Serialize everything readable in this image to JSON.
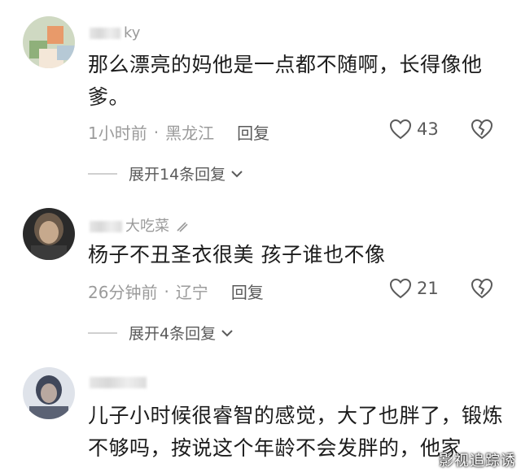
{
  "comments": [
    {
      "username_partial": "ky",
      "text": "那么漂亮的妈他是一点都不随啊，长得像他爹。",
      "time": "1小时前",
      "location": "黑龙江",
      "reply_label": "回复",
      "likes": "43",
      "expand_label": "展开14条回复"
    },
    {
      "username_partial": "大吃菜",
      "text": "杨子不丑圣衣很美 孩子谁也不像",
      "time": "26分钟前",
      "location": "辽宁",
      "reply_label": "回复",
      "likes": "21",
      "expand_label": "展开4条回复"
    },
    {
      "username_partial": "",
      "text": "儿子小时候很睿智的感觉，大了也胖了，锻炼不够吗，按说这个年龄不会发胖的，他家",
      "time": "",
      "location": "",
      "reply_label": "",
      "likes": "",
      "expand_label": ""
    }
  ],
  "watermark": "影视追踪诱",
  "colors": {
    "meta": "#9b9b9b",
    "text": "#1c1c1c",
    "reply": "#5a5a5a"
  }
}
